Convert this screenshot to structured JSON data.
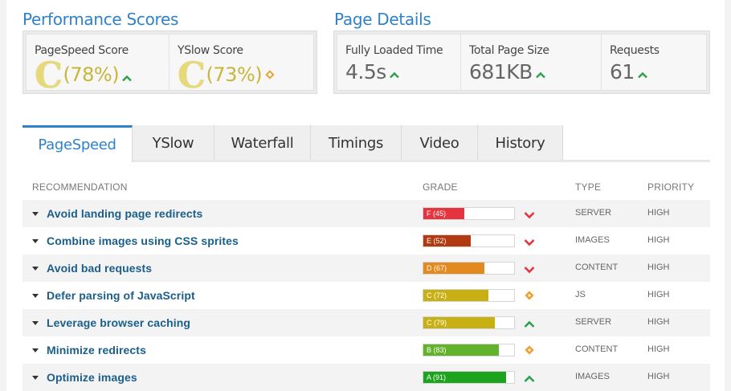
{
  "performance": {
    "title": "Performance Scores",
    "pagespeed": {
      "label": "PageSpeed Score",
      "grade": "C",
      "value": "(78%)",
      "trend": "up"
    },
    "yslow": {
      "label": "YSlow Score",
      "grade": "C",
      "value": "(73%)",
      "trend": "neutral"
    }
  },
  "details": {
    "title": "Page Details",
    "load_time": {
      "label": "Fully Loaded Time",
      "value": "4.5s",
      "trend": "up"
    },
    "page_size": {
      "label": "Total Page Size",
      "value": "681KB",
      "trend": "up"
    },
    "requests": {
      "label": "Requests",
      "value": "61",
      "trend": "up"
    }
  },
  "tabs": [
    {
      "label": "PageSpeed",
      "active": true
    },
    {
      "label": "YSlow",
      "active": false
    },
    {
      "label": "Waterfall",
      "active": false
    },
    {
      "label": "Timings",
      "active": false
    },
    {
      "label": "Video",
      "active": false
    },
    {
      "label": "History",
      "active": false
    }
  ],
  "table": {
    "headers": {
      "recommendation": "RECOMMENDATION",
      "grade": "GRADE",
      "type": "TYPE",
      "priority": "PRIORITY"
    },
    "rows": [
      {
        "name": "Avoid landing page redirects",
        "grade_label": "F (45)",
        "score": 45,
        "color": "#e5343d",
        "indicator": "down",
        "type": "SERVER",
        "priority": "HIGH"
      },
      {
        "name": "Combine images using CSS sprites",
        "grade_label": "E (52)",
        "score": 52,
        "color": "#b23a10",
        "indicator": "down",
        "type": "IMAGES",
        "priority": "HIGH"
      },
      {
        "name": "Avoid bad requests",
        "grade_label": "D (67)",
        "score": 67,
        "color": "#e38a1e",
        "indicator": "down",
        "type": "CONTENT",
        "priority": "HIGH"
      },
      {
        "name": "Defer parsing of JavaScript",
        "grade_label": "C (72)",
        "score": 72,
        "color": "#c8b012",
        "indicator": "neutral",
        "type": "JS",
        "priority": "HIGH"
      },
      {
        "name": "Leverage browser caching",
        "grade_label": "C (79)",
        "score": 79,
        "color": "#c8b012",
        "indicator": "up",
        "type": "SERVER",
        "priority": "HIGH"
      },
      {
        "name": "Minimize redirects",
        "grade_label": "B (83)",
        "score": 83,
        "color": "#62b22c",
        "indicator": "neutral",
        "type": "CONTENT",
        "priority": "HIGH"
      },
      {
        "name": "Optimize images",
        "grade_label": "A (91)",
        "score": 91,
        "color": "#1ea31e",
        "indicator": "up",
        "type": "IMAGES",
        "priority": "HIGH"
      }
    ]
  },
  "colors": {
    "accent": "#2f82c9",
    "link": "#1a5e8a",
    "up": "#2aa24a",
    "down": "#e5343d",
    "neutral": "#f0a030"
  }
}
